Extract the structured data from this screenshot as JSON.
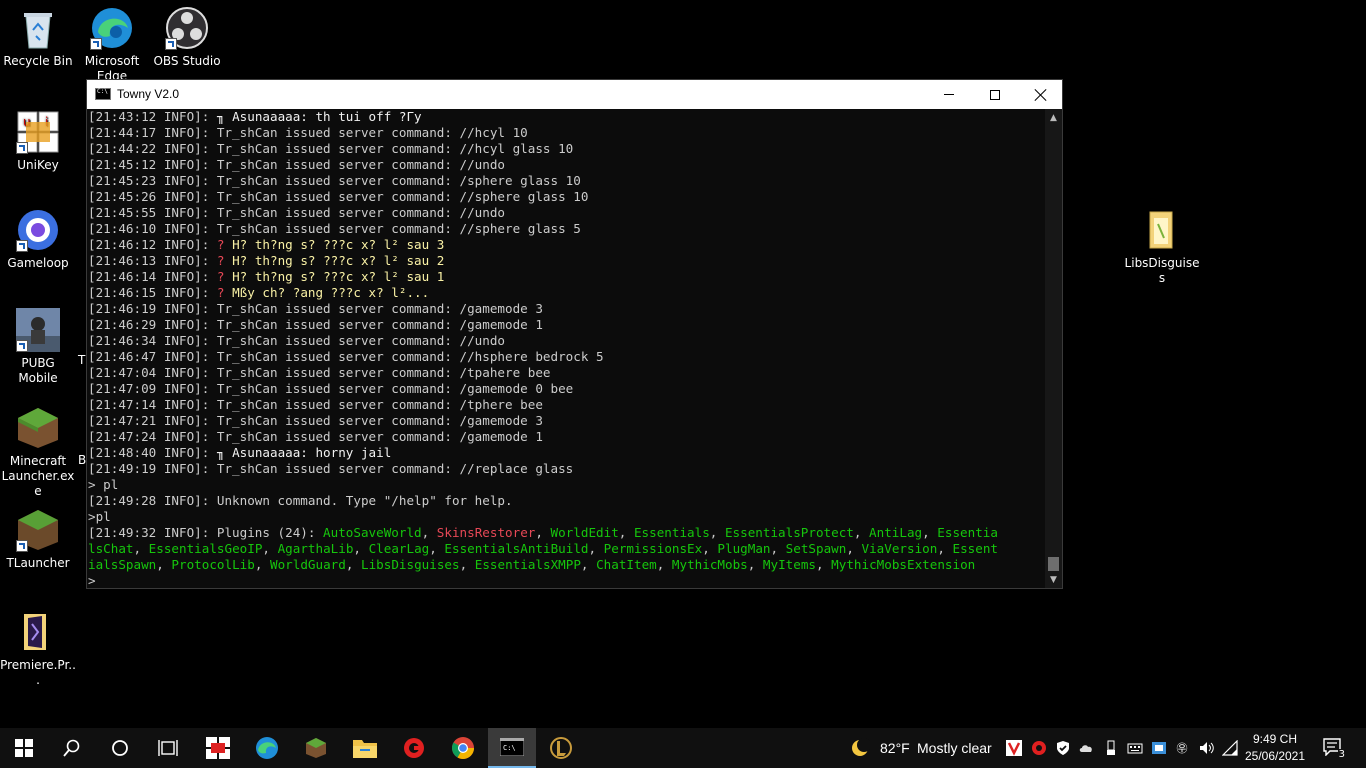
{
  "desktop": {
    "icons": [
      {
        "label": "Recycle Bin",
        "icon": "recycle-bin-icon"
      },
      {
        "label": "Microsoft Edge",
        "icon": "edge-icon"
      },
      {
        "label": "OBS Studio",
        "icon": "obs-icon"
      },
      {
        "label": "UniKey",
        "icon": "unikey-icon"
      },
      {
        "label": "Gameloop",
        "icon": "gameloop-icon"
      },
      {
        "label": "PUBG Mobile",
        "icon": "pubg-icon"
      },
      {
        "label": "Minecraft Launcher.exe",
        "icon": "minecraft-icon"
      },
      {
        "label": "TLauncher",
        "icon": "tlauncher-icon"
      },
      {
        "label": "Premiere.Pr...",
        "icon": "folder-icon"
      },
      {
        "label": "LibsDisguises",
        "icon": "folder-icon"
      }
    ],
    "partial_labels": {
      "t": "T",
      "b": "B"
    }
  },
  "console": {
    "title": "Towny V2.0",
    "lines": [
      [
        {
          "t": "[21:43:12 INFO]: ",
          "c": "default"
        },
        {
          "t": "╖ Asunaaaaa: th tui off ?Гу",
          "c": "white"
        }
      ],
      [
        {
          "t": "[21:44:17 INFO]: Tr_shCan issued server command: //hcyl 10",
          "c": "default"
        }
      ],
      [
        {
          "t": "[21:44:22 INFO]: Tr_shCan issued server command: //hcyl glass 10",
          "c": "default"
        }
      ],
      [
        {
          "t": "[21:45:12 INFO]: Tr_shCan issued server command: //undo",
          "c": "default"
        }
      ],
      [
        {
          "t": "[21:45:23 INFO]: Tr_shCan issued server command: /sphere glass 10",
          "c": "default"
        }
      ],
      [
        {
          "t": "[21:45:26 INFO]: Tr_shCan issued server command: //sphere glass 10",
          "c": "default"
        }
      ],
      [
        {
          "t": "[21:45:55 INFO]: Tr_shCan issued server command: //undo",
          "c": "default"
        }
      ],
      [
        {
          "t": "[21:46:10 INFO]: Tr_shCan issued server command: //sphere glass 5",
          "c": "default"
        }
      ],
      [
        {
          "t": "[21:46:12 INFO]: ",
          "c": "default"
        },
        {
          "t": "? ",
          "c": "red"
        },
        {
          "t": "H? th?ng s? ???c x? l² sau 3",
          "c": "yellow"
        }
      ],
      [
        {
          "t": "[21:46:13 INFO]: ",
          "c": "default"
        },
        {
          "t": "? ",
          "c": "red"
        },
        {
          "t": "H? th?ng s? ???c x? l² sau 2",
          "c": "yellow"
        }
      ],
      [
        {
          "t": "[21:46:14 INFO]: ",
          "c": "default"
        },
        {
          "t": "? ",
          "c": "red"
        },
        {
          "t": "H? th?ng s? ???c x? l² sau 1",
          "c": "yellow"
        }
      ],
      [
        {
          "t": "[21:46:15 INFO]: ",
          "c": "default"
        },
        {
          "t": "? ",
          "c": "red"
        },
        {
          "t": "Mßy ch? ?ang ???c x? l²...",
          "c": "yellow"
        }
      ],
      [
        {
          "t": "[21:46:19 INFO]: Tr_shCan issued server command: /gamemode 3",
          "c": "default"
        }
      ],
      [
        {
          "t": "[21:46:29 INFO]: Tr_shCan issued server command: /gamemode 1",
          "c": "default"
        }
      ],
      [
        {
          "t": "[21:46:34 INFO]: Tr_shCan issued server command: //undo",
          "c": "default"
        }
      ],
      [
        {
          "t": "[21:46:47 INFO]: Tr_shCan issued server command: //hsphere bedrock 5",
          "c": "default"
        }
      ],
      [
        {
          "t": "[21:47:04 INFO]: Tr_shCan issued server command: /tpahere bee",
          "c": "default"
        }
      ],
      [
        {
          "t": "[21:47:09 INFO]: Tr_shCan issued server command: /gamemode 0 bee",
          "c": "default"
        }
      ],
      [
        {
          "t": "[21:47:14 INFO]: Tr_shCan issued server command: /tphere bee",
          "c": "default"
        }
      ],
      [
        {
          "t": "[21:47:21 INFO]: Tr_shCan issued server command: /gamemode 3",
          "c": "default"
        }
      ],
      [
        {
          "t": "[21:47:24 INFO]: Tr_shCan issued server command: /gamemode 1",
          "c": "default"
        }
      ],
      [
        {
          "t": "[21:48:40 INFO]: ",
          "c": "default"
        },
        {
          "t": "╖ Asunaaaaa: horny jail",
          "c": "white"
        }
      ],
      [
        {
          "t": "[21:49:19 INFO]: Tr_shCan issued server command: //replace glass",
          "c": "default"
        }
      ],
      [
        {
          "t": "> pl",
          "c": "default"
        }
      ],
      [
        {
          "t": "[21:49:28 INFO]: Unknown command. Type \"/help\" for help.",
          "c": "default"
        }
      ],
      [
        {
          "t": ">pl",
          "c": "default"
        }
      ],
      [
        {
          "t": "[21:49:32 INFO]: Plugins (24): ",
          "c": "default"
        },
        {
          "t": "AutoSaveWorld",
          "c": "green"
        },
        {
          "t": ", ",
          "c": "default"
        },
        {
          "t": "SkinsRestorer",
          "c": "lred"
        },
        {
          "t": ", ",
          "c": "default"
        },
        {
          "t": "WorldEdit",
          "c": "green"
        },
        {
          "t": ", ",
          "c": "default"
        },
        {
          "t": "Essentials",
          "c": "green"
        },
        {
          "t": ", ",
          "c": "default"
        },
        {
          "t": "EssentialsProtect",
          "c": "green"
        },
        {
          "t": ", ",
          "c": "default"
        },
        {
          "t": "AntiLag",
          "c": "green"
        },
        {
          "t": ", ",
          "c": "default"
        },
        {
          "t": "Essentia",
          "c": "green"
        }
      ],
      [
        {
          "t": "lsChat",
          "c": "green"
        },
        {
          "t": ", ",
          "c": "default"
        },
        {
          "t": "EssentialsGeoIP",
          "c": "green"
        },
        {
          "t": ", ",
          "c": "default"
        },
        {
          "t": "AgarthaLib",
          "c": "green"
        },
        {
          "t": ", ",
          "c": "default"
        },
        {
          "t": "ClearLag",
          "c": "green"
        },
        {
          "t": ", ",
          "c": "default"
        },
        {
          "t": "EssentialsAntiBuild",
          "c": "green"
        },
        {
          "t": ", ",
          "c": "default"
        },
        {
          "t": "PermissionsEx",
          "c": "green"
        },
        {
          "t": ", ",
          "c": "default"
        },
        {
          "t": "PlugMan",
          "c": "green"
        },
        {
          "t": ", ",
          "c": "default"
        },
        {
          "t": "SetSpawn",
          "c": "green"
        },
        {
          "t": ", ",
          "c": "default"
        },
        {
          "t": "ViaVersion",
          "c": "green"
        },
        {
          "t": ", ",
          "c": "default"
        },
        {
          "t": "Essent",
          "c": "green"
        }
      ],
      [
        {
          "t": "ialsSpawn",
          "c": "green"
        },
        {
          "t": ", ",
          "c": "default"
        },
        {
          "t": "ProtocolLib",
          "c": "green"
        },
        {
          "t": ", ",
          "c": "default"
        },
        {
          "t": "WorldGuard",
          "c": "green"
        },
        {
          "t": ", ",
          "c": "default"
        },
        {
          "t": "LibsDisguises",
          "c": "green"
        },
        {
          "t": ", ",
          "c": "default"
        },
        {
          "t": "EssentialsXMPP",
          "c": "green"
        },
        {
          "t": ", ",
          "c": "default"
        },
        {
          "t": "ChatItem",
          "c": "green"
        },
        {
          "t": ", ",
          "c": "default"
        },
        {
          "t": "MythicMobs",
          "c": "green"
        },
        {
          "t": ", ",
          "c": "default"
        },
        {
          "t": "MyItems",
          "c": "green"
        },
        {
          "t": ", ",
          "c": "default"
        },
        {
          "t": "MythicMobsExtension",
          "c": "green"
        }
      ],
      [
        {
          "t": ">",
          "c": "default"
        }
      ]
    ]
  },
  "taskbar": {
    "weather": {
      "temp": "82°F",
      "condition": "Mostly clear"
    },
    "clock": {
      "time": "9:49 CH",
      "date": "25/06/2021"
    },
    "notification_count": "3"
  }
}
